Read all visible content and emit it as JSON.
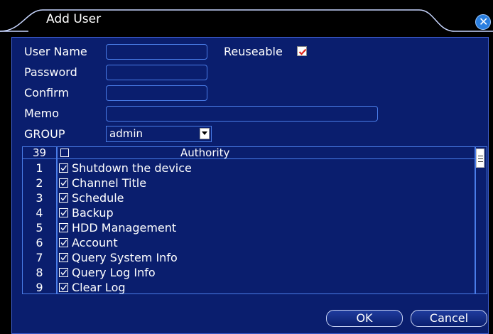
{
  "window": {
    "title": "Add User"
  },
  "form": {
    "user_name_label": "User Name",
    "user_name_value": "",
    "reuseable_label": "Reuseable",
    "reuseable_checked": true,
    "password_label": "Password",
    "password_value": "",
    "confirm_label": "Confirm",
    "confirm_value": "",
    "memo_label": "Memo",
    "memo_value": "",
    "group_label": "GROUP",
    "group_value": "admin"
  },
  "authority_table": {
    "count": "39",
    "header": "Authority",
    "rows": [
      {
        "num": "1",
        "label": "Shutdown the device",
        "checked": true
      },
      {
        "num": "2",
        "label": "Channel Title",
        "checked": true
      },
      {
        "num": "3",
        "label": "Schedule",
        "checked": true
      },
      {
        "num": "4",
        "label": "Backup",
        "checked": true
      },
      {
        "num": "5",
        "label": "HDD Management",
        "checked": true
      },
      {
        "num": "6",
        "label": "Account",
        "checked": true
      },
      {
        "num": "7",
        "label": "Query System Info",
        "checked": true
      },
      {
        "num": "8",
        "label": "Query Log Info",
        "checked": true
      },
      {
        "num": "9",
        "label": "Clear Log",
        "checked": true
      }
    ]
  },
  "buttons": {
    "ok": "OK",
    "cancel": "Cancel"
  },
  "colors": {
    "panel_bg": "#0a1e6e",
    "border": "#4a7de8",
    "checkmark_red": "#e0231a"
  }
}
